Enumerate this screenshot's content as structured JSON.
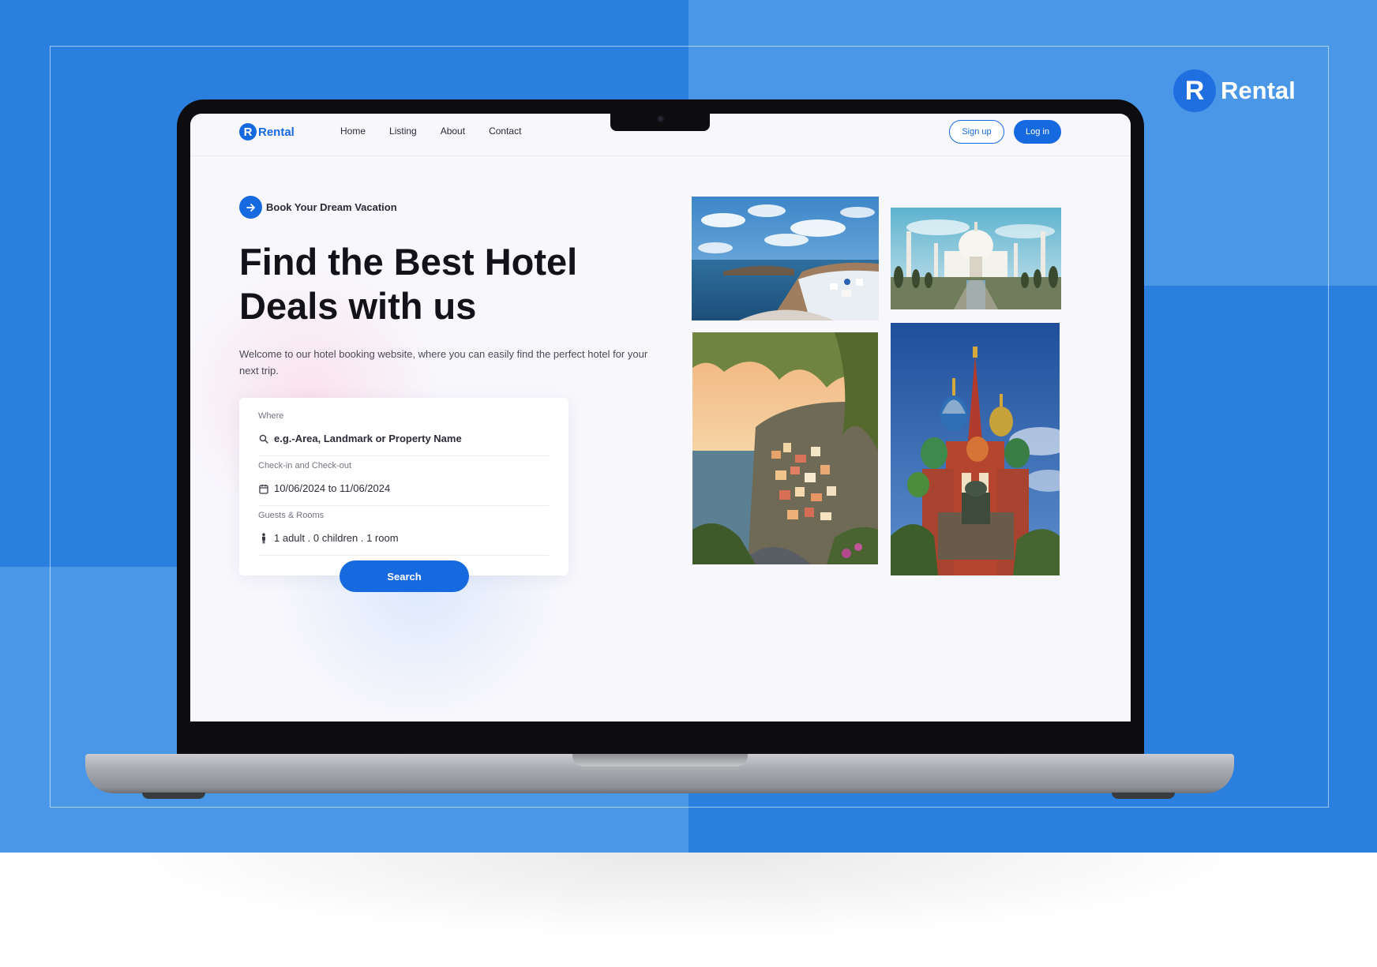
{
  "corner_brand": {
    "logo_letter": "R",
    "name": "Rental"
  },
  "site": {
    "logo_letter": "R",
    "logo_text": "Rental",
    "nav": [
      {
        "label": "Home"
      },
      {
        "label": "Listing"
      },
      {
        "label": "About"
      },
      {
        "label": "Contact"
      }
    ],
    "signup_label": "Sign up",
    "login_label": "Log in"
  },
  "hero": {
    "tagline": "Book Your Dream Vacation",
    "title": "Find the Best Hotel Deals with us",
    "description": "Welcome to our hotel booking website, where you can easily find the perfect hotel for your next trip."
  },
  "search": {
    "where": {
      "label": "Where",
      "value": "e.g.-Area, Landmark or Property Name"
    },
    "dates": {
      "label": "Check-in and Check-out",
      "value": "10/06/2024 to 11/06/2024"
    },
    "guests": {
      "label": "Guests & Rooms",
      "value": "1 adult . 0 children . 1 room"
    },
    "button_label": "Search"
  },
  "colors": {
    "accent": "#1769e0",
    "background_dark": "#2b7fdf",
    "background_light": "#4a97e8",
    "screen_bg": "#f8f7fc"
  },
  "icons": {
    "tagline": "arrow-right-icon",
    "where": "search-icon",
    "dates": "calendar-icon",
    "guests": "person-icon"
  }
}
